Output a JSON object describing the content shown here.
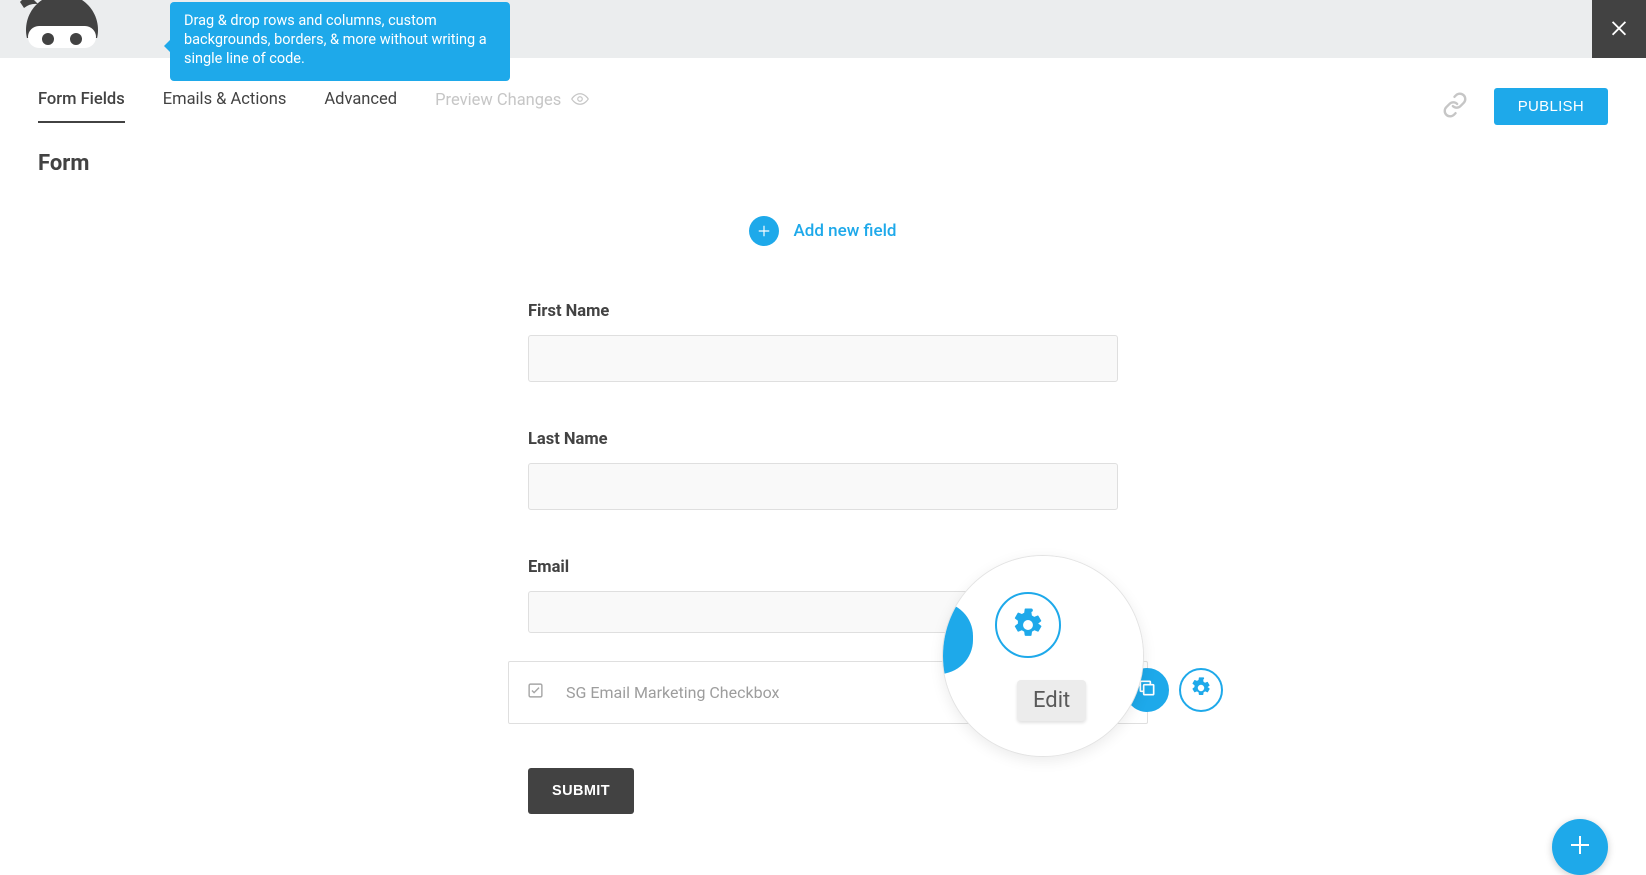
{
  "tooltip": "Drag & drop rows and columns, custom backgrounds, borders, & more without writing a single line of code.",
  "tabs": {
    "form_fields": "Form Fields",
    "emails_actions": "Emails & Actions",
    "advanced": "Advanced",
    "preview": "Preview Changes"
  },
  "publish_label": "PUBLISH",
  "page_title": "Form",
  "add_field_label": "Add new field",
  "fields": {
    "first_name": {
      "label": "First Name",
      "value": ""
    },
    "last_name": {
      "label": "Last Name",
      "value": ""
    },
    "email": {
      "label": "Email",
      "value": ""
    }
  },
  "checkbox_field": {
    "label": "SG Email Marketing Checkbox"
  },
  "submit_label": "SUBMIT",
  "magnifier_tooltip": "Edit"
}
